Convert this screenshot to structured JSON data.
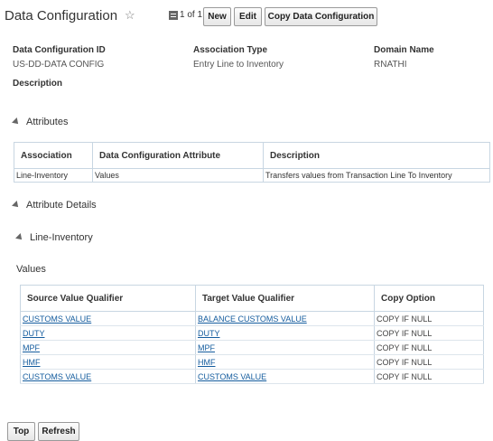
{
  "header": {
    "title": "Data Configuration",
    "record_counter": "1 of 1",
    "buttons": {
      "new": "New",
      "edit": "Edit",
      "copy": "Copy Data Configuration"
    }
  },
  "fields": {
    "id_label": "Data Configuration ID",
    "id_value": "US-DD-DATA CONFIG",
    "assoc_type_label": "Association Type",
    "assoc_type_value": "Entry Line to Inventory",
    "domain_label": "Domain Name",
    "domain_value": "RNATHI",
    "description_label": "Description"
  },
  "sections": {
    "attributes": "Attributes",
    "attribute_details": "Attribute Details",
    "line_inventory": "Line-Inventory",
    "values": "Values"
  },
  "attributes_table": {
    "columns": [
      "Association",
      "Data Configuration Attribute",
      "Description"
    ],
    "rows": [
      [
        "Line-Inventory",
        "Values",
        "Transfers values from Transaction Line To Inventory"
      ]
    ]
  },
  "values_table": {
    "columns": [
      "Source Value Qualifier",
      "Target Value Qualifier",
      "Copy Option"
    ],
    "rows": [
      [
        "CUSTOMS VALUE",
        "BALANCE CUSTOMS VALUE",
        "COPY IF NULL"
      ],
      [
        "DUTY",
        "DUTY",
        "COPY IF NULL"
      ],
      [
        "MPF",
        "MPF",
        "COPY IF NULL"
      ],
      [
        "HMF",
        "HMF",
        "COPY IF NULL"
      ],
      [
        "CUSTOMS VALUE",
        "CUSTOMS VALUE",
        "COPY IF NULL"
      ]
    ]
  },
  "footer": {
    "top": "Top",
    "refresh": "Refresh"
  },
  "icons": {
    "favorite": "star-outline-icon",
    "record_list": "list-icon",
    "collapse": "expanded-triangle-icon"
  }
}
